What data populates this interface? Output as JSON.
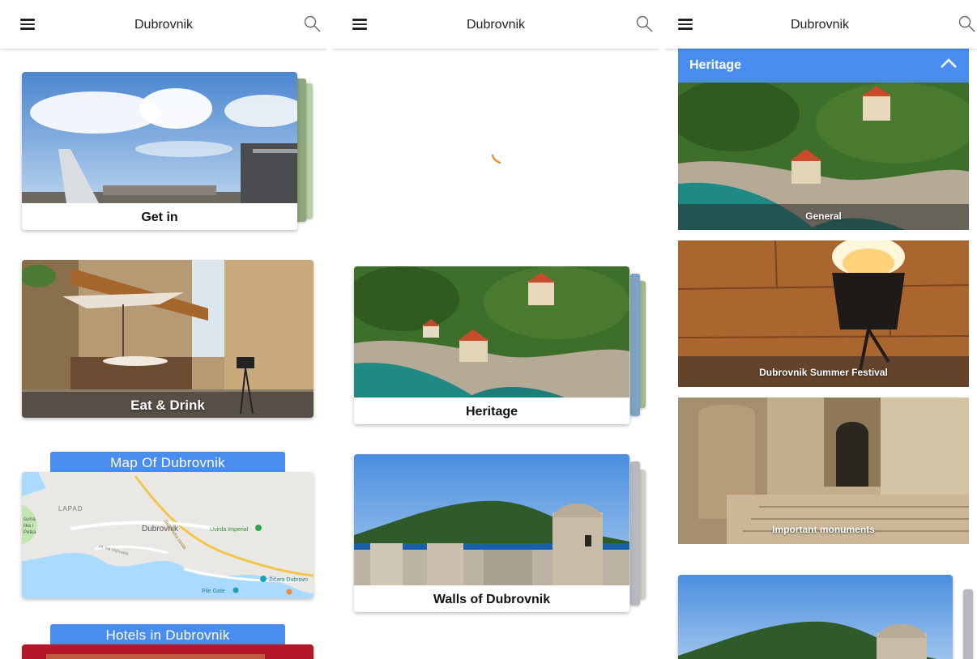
{
  "app": {
    "city": "Dubrovnik"
  },
  "icons": {
    "menu": "menu-icon",
    "search": "search-icon",
    "collapse": "chevron-up-icon",
    "pin": "map-pin-icon"
  },
  "colors": {
    "accent": "#4a8df0",
    "spinner": "#e8932e"
  },
  "panel1": {
    "cards": [
      {
        "label": "Get in"
      },
      {
        "label": "Eat & Drink"
      }
    ],
    "map_tab": "Map Of Dubrovnik",
    "map_labels": {
      "lapad": "LAPAD",
      "dubrovnik": "Dubrovnik",
      "hotel": "Uvirda Imperial",
      "suma": "šuma",
      "lika": "lika i",
      "petka": "Petka",
      "street": "UI. Iva Vojnovića",
      "road": "Jadranska cesta",
      "cable": "Žičara Dubrovn",
      "gate": "Pile Gate"
    },
    "hotels_tab": "Hotels in Dubrovnik"
  },
  "panel2": {
    "cards": [
      {
        "label": "Heritage"
      },
      {
        "label": "Walls of Dubrovnik"
      }
    ]
  },
  "panel3": {
    "section_title": "Heritage",
    "items": [
      {
        "label": "General"
      },
      {
        "label": "Dubrovnik Summer Festival"
      },
      {
        "label": "Important monuments"
      }
    ]
  }
}
